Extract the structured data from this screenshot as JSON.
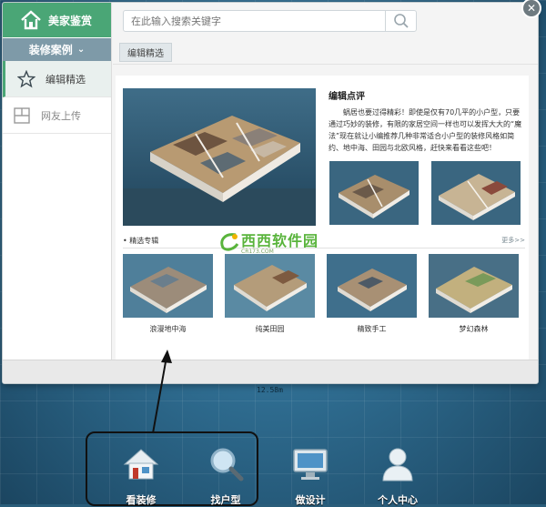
{
  "modal": {
    "brand_title": "美家鉴赏",
    "category_label": "装修案例",
    "nav": [
      {
        "label": "编辑精选",
        "icon": "star-icon",
        "active": true
      },
      {
        "label": "网友上传",
        "icon": "grid-icon",
        "active": false
      }
    ],
    "search": {
      "placeholder": "在此输入搜索关键字"
    },
    "tab_label": "编辑精选",
    "review": {
      "title": "编辑点评",
      "text": "蜗居也要过得精彩！即使是仅有70几平的小户型，只要通过巧妙的装修，有限的家居空间一样也可以发挥大大的“魔法”现在就让小编推荐几种非常适合小户型的装修风格如简约、地中海、田园与北欧风格，赶快来看看这些吧！"
    },
    "section_title": "• 精选专辑",
    "more_label": "更多>>",
    "watermark": {
      "main": "西西软件园",
      "sub": "CR173.COM"
    },
    "albums": [
      {
        "caption": "浪漫地中海"
      },
      {
        "caption": "纯美田园"
      },
      {
        "caption": "精致手工"
      },
      {
        "caption": "梦幻森林"
      }
    ]
  },
  "measure_text": "12.58m",
  "dock": [
    {
      "label": "看装修",
      "icon": "house-icon",
      "active": true
    },
    {
      "label": "找户型",
      "icon": "magnifier-icon",
      "active": false
    },
    {
      "label": "做设计",
      "icon": "monitor-icon",
      "active": false
    },
    {
      "label": "个人中心",
      "icon": "user-icon",
      "active": false
    }
  ],
  "colors": {
    "brand": "#4aa676",
    "category": "#7e9aa8",
    "background": "#2f6d91"
  }
}
